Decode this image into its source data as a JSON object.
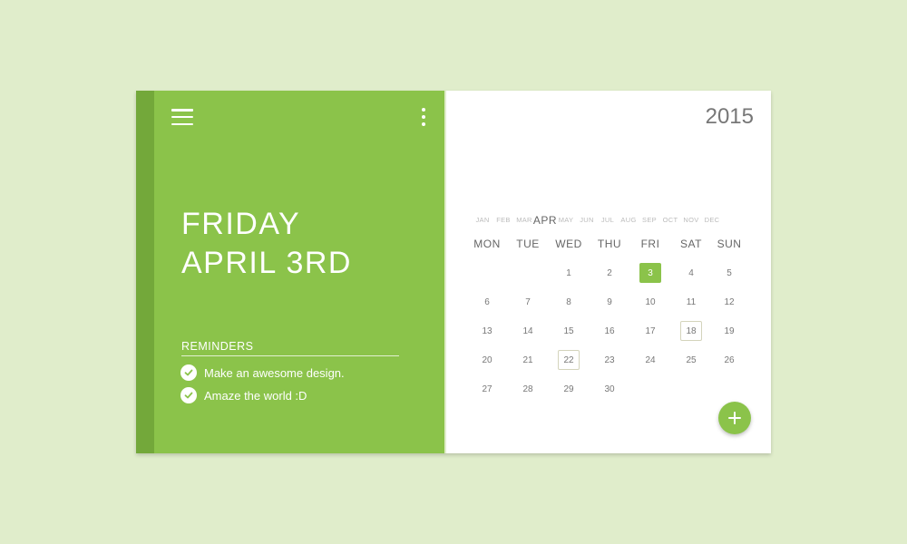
{
  "colors": {
    "accent": "#8bc34a",
    "accent_dark": "#73a83a",
    "background": "#e0edcb"
  },
  "header": {
    "day_name": "FRIDAY",
    "date_text": "APRIL 3RD"
  },
  "reminders": {
    "title": "REMINDERS",
    "items": [
      {
        "label": "Make an awesome design.",
        "icon": "check-circle-icon"
      },
      {
        "label": "Amaze the world :D",
        "icon": "check-circle-icon"
      }
    ]
  },
  "calendar": {
    "year": "2015",
    "months": [
      "JAN",
      "FEB",
      "MAR",
      "APR",
      "MAY",
      "JUN",
      "JUL",
      "AUG",
      "SEP",
      "OCT",
      "NOV",
      "DEC"
    ],
    "active_month": "APR",
    "weekdays": [
      "MON",
      "TUE",
      "WED",
      "THU",
      "FRI",
      "SAT",
      "SUN"
    ],
    "weeks": [
      [
        "",
        "",
        "1",
        "2",
        "3",
        "4",
        "5"
      ],
      [
        "6",
        "7",
        "8",
        "9",
        "10",
        "11",
        "12"
      ],
      [
        "13",
        "14",
        "15",
        "16",
        "17",
        "18",
        "19"
      ],
      [
        "20",
        "21",
        "22",
        "23",
        "24",
        "25",
        "26"
      ],
      [
        "27",
        "28",
        "29",
        "30",
        "",
        "",
        ""
      ]
    ],
    "selected_day": "3",
    "marked_days": [
      "18",
      "22"
    ]
  },
  "icons": {
    "menu": "menu-icon",
    "more": "more-vertical-icon",
    "add": "plus-icon"
  }
}
